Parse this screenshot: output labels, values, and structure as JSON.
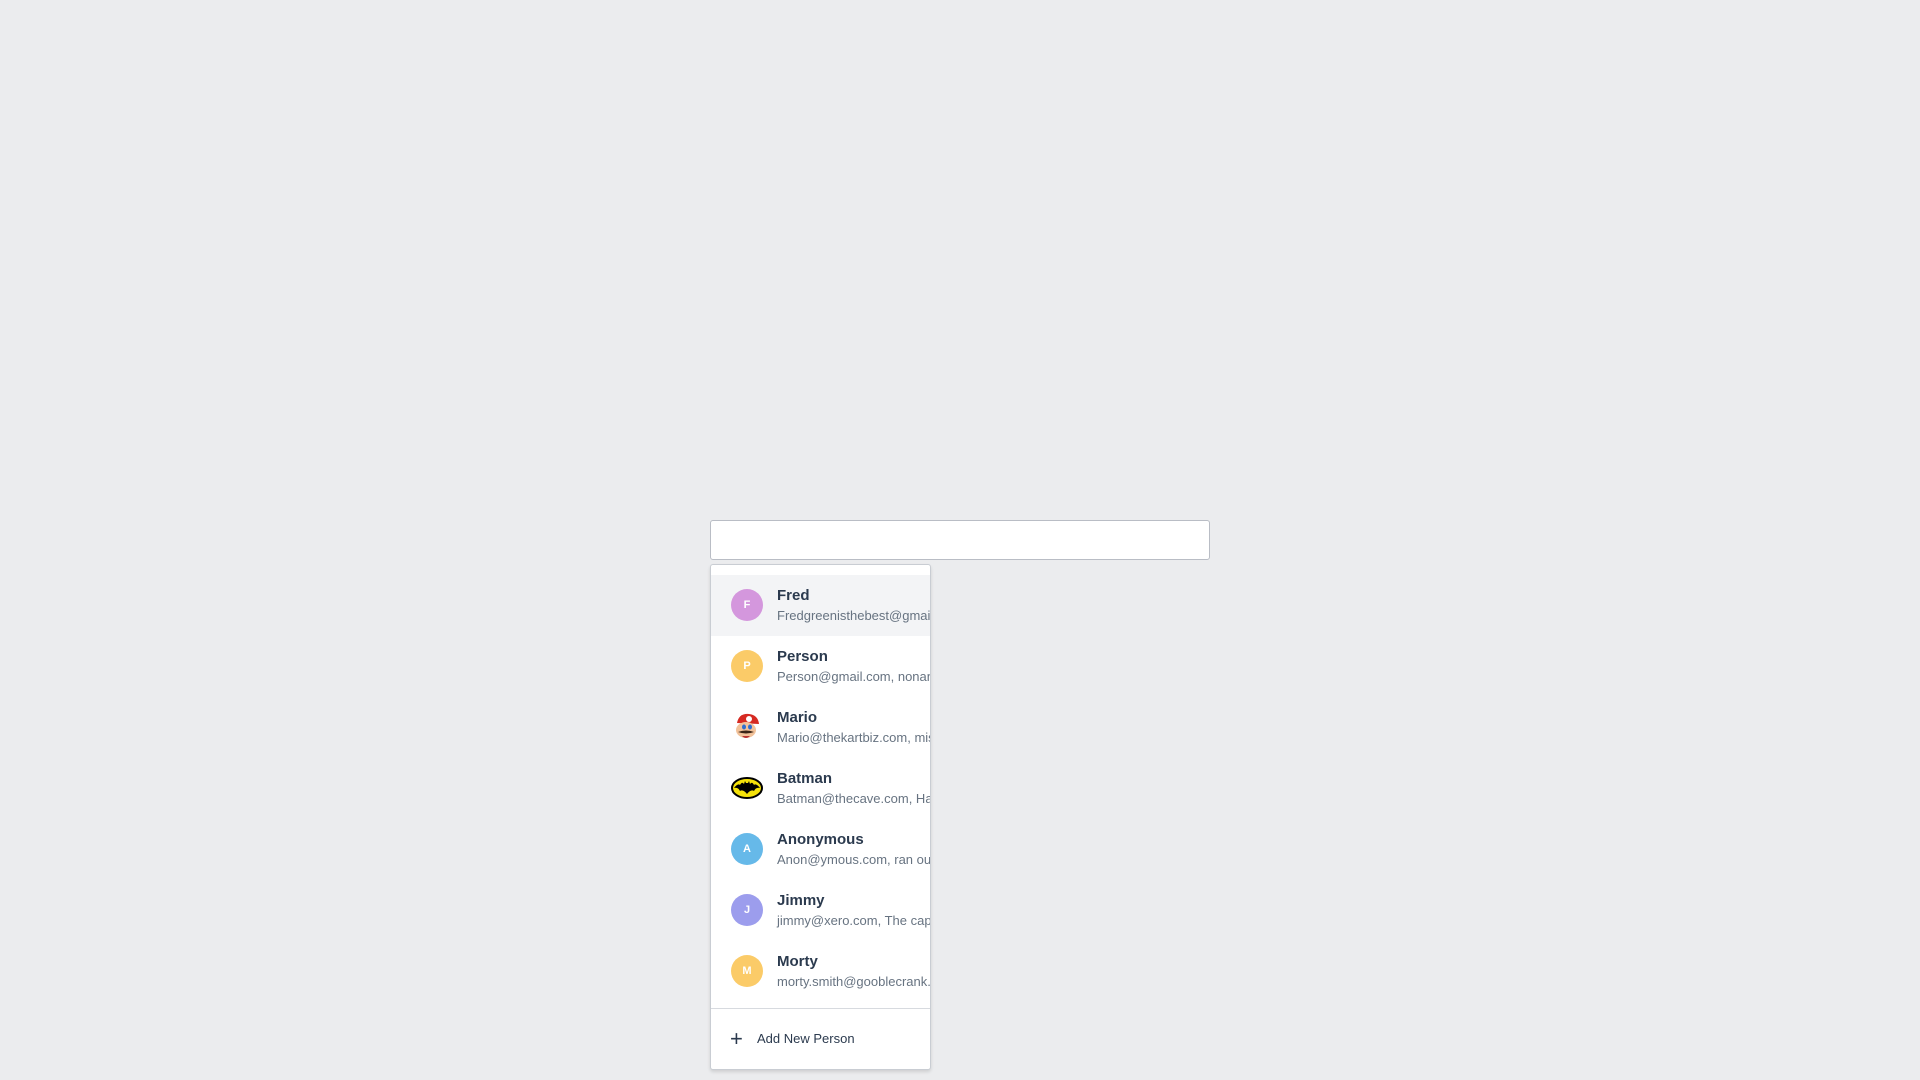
{
  "search": {
    "value": "",
    "placeholder": ""
  },
  "people": [
    {
      "name": "Fred",
      "detail": "Fredgreenisthebest@gmail",
      "initial": "F",
      "color": "#d497dd",
      "avatar": "initial",
      "active": true
    },
    {
      "name": "Person",
      "detail": "Person@gmail.com, nonan",
      "initial": "P",
      "color": "#fbcb68",
      "avatar": "initial"
    },
    {
      "name": "Mario",
      "detail": "Mario@thekartbiz.com, mis",
      "initial": "",
      "color": "",
      "avatar": "mario-image"
    },
    {
      "name": "Batman",
      "detail": "Batman@thecave.com, Ha",
      "initial": "",
      "color": "",
      "avatar": "batman-logo-image"
    },
    {
      "name": "Anonymous",
      "detail": "Anon@ymous.com, ran ou",
      "initial": "A",
      "color": "#66b9e9",
      "avatar": "initial"
    },
    {
      "name": "Jimmy",
      "detail": "jimmy@xero.com, The cap",
      "initial": "J",
      "color": "#9c9ded",
      "avatar": "initial"
    },
    {
      "name": "Morty",
      "detail": "morty.smith@gooblecrank.",
      "initial": "M",
      "color": "#fbcb68",
      "avatar": "initial"
    }
  ],
  "add_person": {
    "label": "Add New Person",
    "icon": "plus-icon"
  }
}
